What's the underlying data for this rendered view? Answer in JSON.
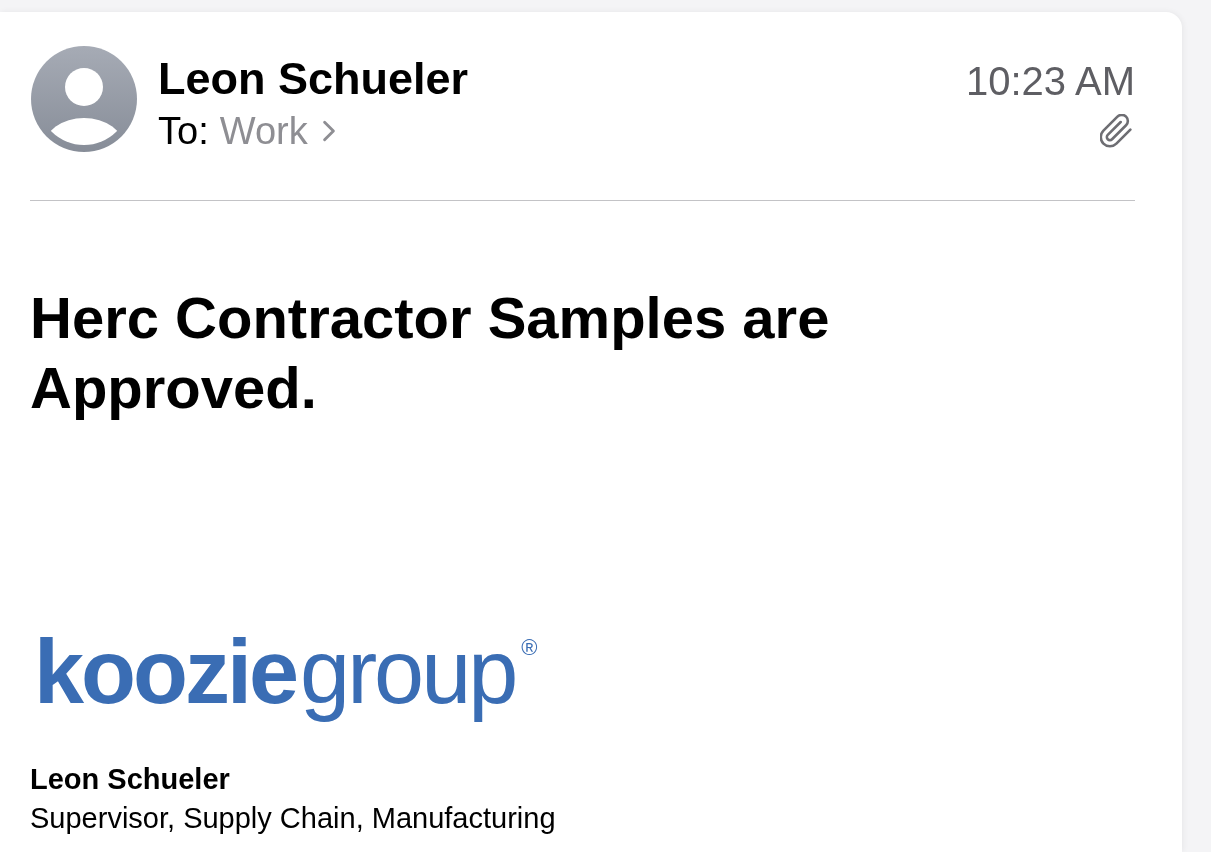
{
  "message": {
    "sender": {
      "name": "Leon Schueler"
    },
    "recipient": {
      "label": "To:",
      "name": "Work"
    },
    "time": "10:23 AM",
    "has_attachment": true,
    "subject": "Herc Contractor Samples are Approved.",
    "signature": {
      "logo": {
        "bold_part": "koozie",
        "light_part": "group",
        "registered_mark": "®"
      },
      "name": "Leon Schueler",
      "title": "Supervisor, Supply Chain, Manufacturing"
    }
  }
}
